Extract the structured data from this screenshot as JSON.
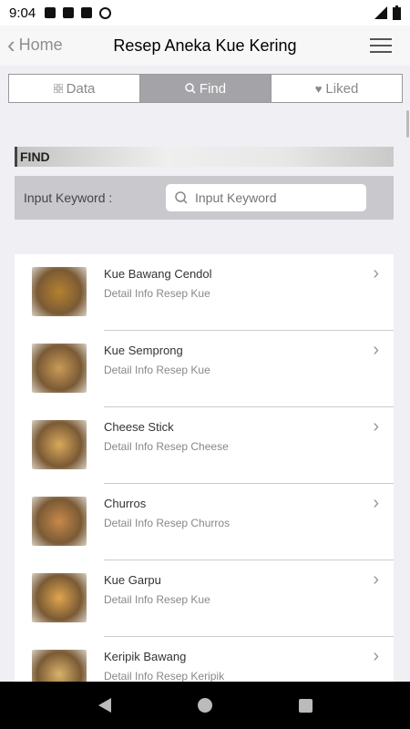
{
  "status": {
    "time": "9:04"
  },
  "nav": {
    "back_label": "Home",
    "title": "Resep Aneka Kue Kering"
  },
  "tabs": [
    {
      "label": "Data",
      "icon": "grid-icon"
    },
    {
      "label": "Find",
      "icon": "search-icon"
    },
    {
      "label": "Liked",
      "icon": "heart-icon"
    }
  ],
  "find": {
    "section_label": "FIND",
    "keyword_label": "Input Keyword :",
    "placeholder": "Input Keyword"
  },
  "recipes": [
    {
      "title": "Kue Bawang Cendol",
      "subtitle": "Detail Info Resep Kue",
      "color": "#b5812f"
    },
    {
      "title": "Kue Semprong",
      "subtitle": "Detail Info Resep Kue",
      "color": "#c99a57"
    },
    {
      "title": "Cheese Stick",
      "subtitle": "Detail Info Resep Cheese",
      "color": "#d9a85b"
    },
    {
      "title": "Churros",
      "subtitle": "Detail Info Resep Churros",
      "color": "#c7884a"
    },
    {
      "title": "Kue Garpu",
      "subtitle": "Detail Info Resep Kue",
      "color": "#e0a54f"
    },
    {
      "title": "Keripik Bawang",
      "subtitle": "Detail Info Resep Keripik",
      "color": "#d9b36a"
    }
  ]
}
